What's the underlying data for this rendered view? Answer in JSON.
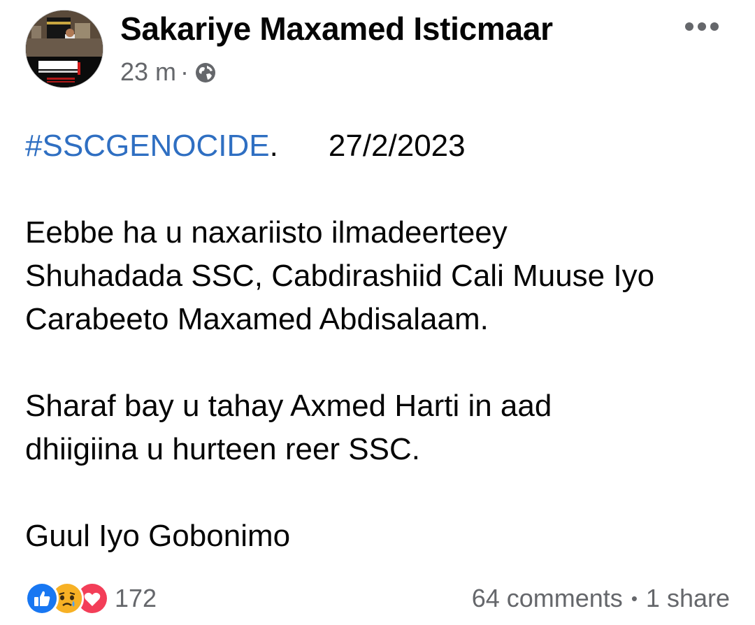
{
  "post": {
    "author": "Sakariye Maxamed Isticmaar",
    "timestamp": "23 m",
    "meta_separator": "·",
    "privacy_icon": "globe-icon",
    "more_icon": "more-horizontal-icon",
    "hashtag": "#SSCGENOCIDE",
    "hashtag_suffix": ".",
    "date": "27/2/2023",
    "paragraphs": [
      "Eebbe ha u naxariisto ilmadeerteey Shuhadada SSC, Cabdirashiid Cali Muuse Iyo Carabeeto Maxamed Abdisalaam.",
      "Sharaf bay u tahay Axmed Harti in aad dhiigiina u hurteen reer SSC.",
      "Guul Iyo Gobonimo"
    ],
    "line_breaks": {
      "p1": [
        "Eebbe ha u naxariisto ilmadeerteey",
        "Shuhadada SSC, Cabdirashiid Cali Muuse Iyo",
        "Carabeeto Maxamed Abdisalaam."
      ],
      "p2": [
        "Sharaf bay u tahay Axmed Harti in aad",
        "dhiigiina u hurteen reer SSC."
      ]
    }
  },
  "footer": {
    "reaction_icons": [
      "like-icon",
      "sad-icon",
      "love-icon"
    ],
    "reaction_count": "172",
    "comments": "64 comments",
    "separator": "•",
    "shares": "1 share"
  },
  "colors": {
    "hashtag": "#2f6fc2",
    "secondary_text": "#65676b",
    "like": "#1877f2",
    "love": "#f33e58",
    "sad": "#f7b125"
  }
}
